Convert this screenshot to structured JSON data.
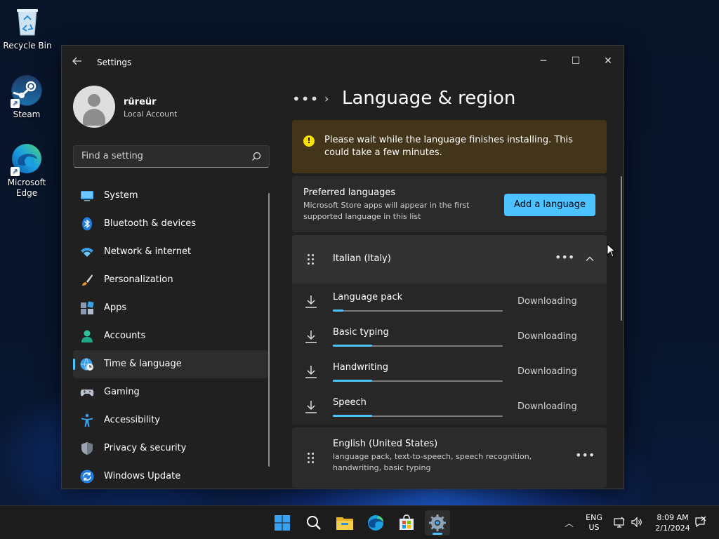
{
  "desktop": {
    "icons": [
      {
        "label": "Recycle Bin"
      },
      {
        "label": "Steam"
      },
      {
        "label": "Microsoft Edge"
      }
    ]
  },
  "window": {
    "title": "Settings",
    "controls": {
      "minimize": "─",
      "maximize": "☐",
      "close": "✕"
    }
  },
  "user": {
    "name": "rüreür",
    "account_type": "Local Account"
  },
  "search": {
    "placeholder": "Find a setting"
  },
  "sidebar": {
    "items": [
      {
        "label": "System",
        "icon": "monitor-icon"
      },
      {
        "label": "Bluetooth & devices",
        "icon": "bluetooth-icon"
      },
      {
        "label": "Network & internet",
        "icon": "wifi-icon"
      },
      {
        "label": "Personalization",
        "icon": "brush-icon"
      },
      {
        "label": "Apps",
        "icon": "apps-icon"
      },
      {
        "label": "Accounts",
        "icon": "person-icon"
      },
      {
        "label": "Time & language",
        "icon": "globe-clock-icon",
        "active": true
      },
      {
        "label": "Gaming",
        "icon": "gamepad-icon"
      },
      {
        "label": "Accessibility",
        "icon": "accessibility-icon"
      },
      {
        "label": "Privacy & security",
        "icon": "shield-icon"
      },
      {
        "label": "Windows Update",
        "icon": "update-icon"
      }
    ]
  },
  "breadcrumb": {
    "overflow": "•••",
    "separator": "›",
    "title": "Language & region"
  },
  "warning": {
    "text": "Please wait while the language finishes installing. This could take a few minutes."
  },
  "preferred": {
    "heading": "Preferred languages",
    "description": "Microsoft Store apps will appear in the first supported language in this list",
    "add_button": "Add a language"
  },
  "languages": [
    {
      "name": "Italian (Italy)",
      "expanded": true,
      "features": [
        {
          "name": "Language pack",
          "status": "Downloading",
          "progress": 0.06
        },
        {
          "name": "Basic typing",
          "status": "Downloading",
          "progress": 0.23
        },
        {
          "name": "Handwriting",
          "status": "Downloading",
          "progress": 0.23
        },
        {
          "name": "Speech",
          "status": "Downloading",
          "progress": 0.23
        }
      ]
    },
    {
      "name": "English (United States)",
      "description": "language pack, text-to-speech, speech recognition, handwriting, basic typing"
    }
  ],
  "more_glyph": "•••",
  "taskbar": {
    "apps": [
      "start-icon",
      "search-icon",
      "file-explorer-icon",
      "edge-icon",
      "store-icon",
      "settings-icon"
    ],
    "active_app": "settings-icon",
    "tray": {
      "chevron": "︿",
      "lang_line1": "ENG",
      "lang_line2": "US",
      "time": "8:09 AM",
      "date": "2/1/2024"
    }
  },
  "colors": {
    "accent": "#4cc2ff",
    "warning_bg": "#433519",
    "warning_icon": "#fce100",
    "window_bg": "#202020",
    "card_bg": "#2b2b2b"
  }
}
